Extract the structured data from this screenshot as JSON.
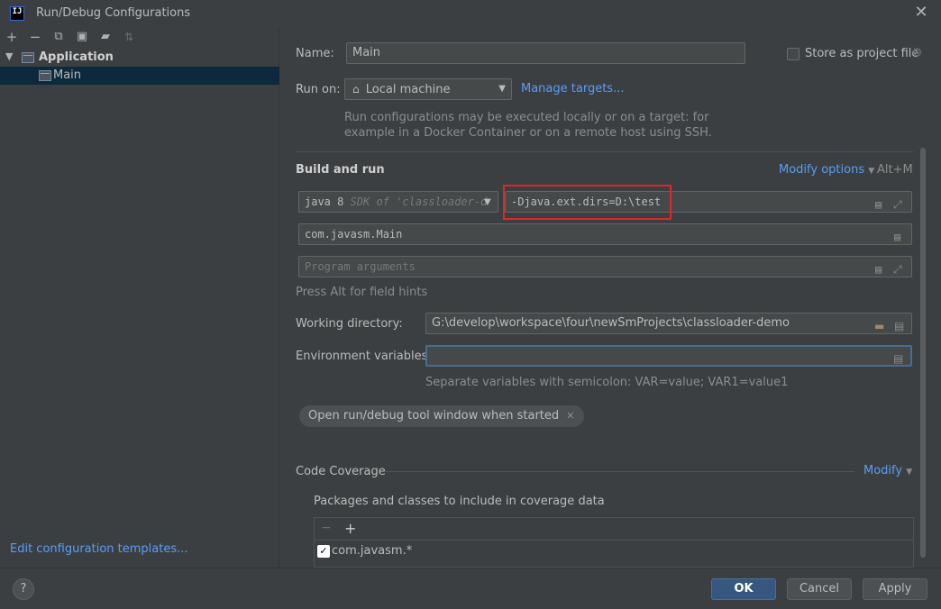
{
  "window": {
    "title": "Run/Debug Configurations",
    "app_icon_text": "IJ"
  },
  "toolbar": {
    "icons": [
      "add-icon",
      "remove-icon",
      "copy-icon",
      "save-icon",
      "folder-add-icon",
      "sort-icon"
    ]
  },
  "tree": {
    "group_label": "Application",
    "item_label": "Main"
  },
  "left_footer": {
    "link": "Edit configuration templates..."
  },
  "form": {
    "name_label": "Name:",
    "name_value": "Main",
    "store_label": "Store as project file",
    "run_on_label": "Run on:",
    "run_on_value": "Local machine",
    "manage_targets": "Manage targets...",
    "run_on_note_1": "Run configurations may be executed locally or on a target: for",
    "run_on_note_2": "example in a Docker Container or on a remote host using SSH.",
    "build_run_title": "Build and run",
    "modify_options": "Modify options",
    "modify_shortcut": "Alt+M",
    "jdk_main": "java 8",
    "jdk_sdk": "SDK of 'classloader-d",
    "vm_options": "-Djava.ext.dirs=D:\\test",
    "main_class": "com.javasm.Main",
    "program_args_placeholder": "Program arguments",
    "field_hint": "Press Alt for field hints",
    "working_dir_label": "Working directory:",
    "working_dir_value": "G:\\develop\\workspace\\four\\newSmProjects\\classloader-demo",
    "env_label": "Environment variables:",
    "env_value": "",
    "env_note": "Separate variables with semicolon: VAR=value; VAR1=value1",
    "chip_label": "Open run/debug tool window when started",
    "coverage_title": "Code Coverage",
    "coverage_modify": "Modify",
    "packages_label": "Packages and classes to include in coverage data",
    "coverage_item": "com.javasm.*",
    "coverage_item_checked": true
  },
  "buttons": {
    "ok": "OK",
    "cancel": "Cancel",
    "apply": "Apply",
    "help": "?"
  },
  "colors": {
    "accent": "#589df6",
    "highlight_box": "#e0262b",
    "ok_button": "#365880",
    "selection": "#0d293e"
  }
}
